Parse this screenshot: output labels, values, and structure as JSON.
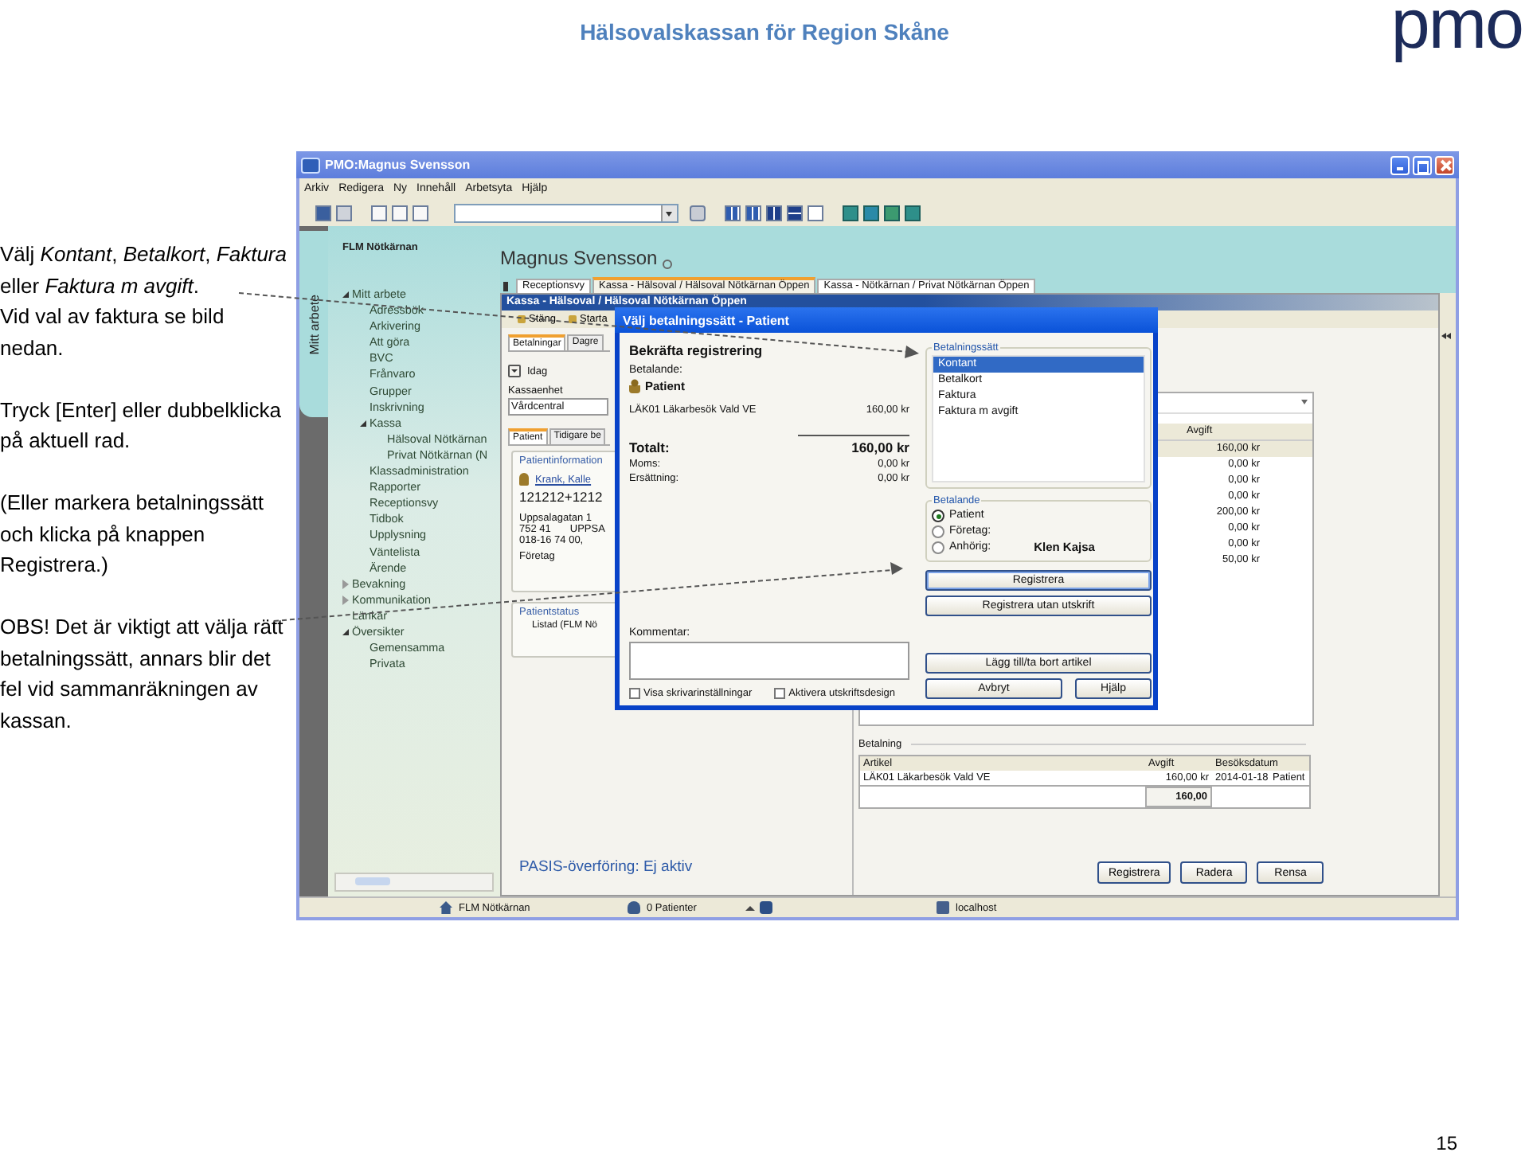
{
  "page_title": "Hälsovalskassan för Region Skåne",
  "logo": "pmo",
  "instructions": [
    "Välj *Kontant*, *Betalkort*, *Faktura* eller *Faktura m avgift*.",
    "Vid val av faktura se bild nedan.",
    "Tryck [Enter] eller dubbelklicka på aktuell rad.",
    "(Eller markera betalningssätt och klicka på knappen Registrera.)",
    "OBS! Det är viktigt att välja rätt betalningssätt, annars blir det fel vid sammanräkningen av kassan."
  ],
  "page_number": "15",
  "app": {
    "window_title": "PMO:Magnus Svensson",
    "menu": [
      "Arkiv",
      "Redigera",
      "Ny",
      "Innehåll",
      "Arbetsyta",
      "Hjälp"
    ],
    "side_tab": "Mitt arbete",
    "unit": "FLM Nötkärnan",
    "user": "Magnus Svensson",
    "tree": [
      {
        "label": "Mitt arbete",
        "expanded": true,
        "children": [
          {
            "label": "Adressbök"
          },
          {
            "label": "Arkivering"
          },
          {
            "label": "Att göra"
          },
          {
            "label": "BVC"
          },
          {
            "label": "Frånvaro"
          },
          {
            "label": "Grupper"
          },
          {
            "label": "Inskrivning"
          },
          {
            "label": "Kassa",
            "expanded": true,
            "children": [
              {
                "label": "Hälsoval Nötkärnan"
              },
              {
                "label": "Privat Nötkärnan (N"
              }
            ]
          },
          {
            "label": "Klassadministration"
          },
          {
            "label": "Rapporter"
          },
          {
            "label": "Receptionsvy"
          },
          {
            "label": "Tidbok"
          },
          {
            "label": "Upplysning"
          },
          {
            "label": "Väntelista"
          },
          {
            "label": "Ärende"
          }
        ]
      },
      {
        "label": "Bevakning",
        "expanded": false
      },
      {
        "label": "Kommunikation",
        "expanded": false
      },
      {
        "label": "Länkar"
      },
      {
        "label": "Översikter",
        "expanded": true,
        "children": [
          {
            "label": "Gemensamma"
          },
          {
            "label": "Privata"
          }
        ]
      }
    ],
    "tabs": [
      {
        "label": "Receptionsvy",
        "selected": false
      },
      {
        "label": "Kassa - Hälsoval / Hälsoval Nötkärnan Öppen",
        "selected": true
      },
      {
        "label": "Kassa - Nötkärnan / Privat Nötkärnan Öppen",
        "selected": false
      }
    ],
    "kassa": {
      "title": "Kassa - Hälsoval / Hälsoval Nötkärnan Öppen",
      "toolbar": [
        "Stäng",
        "Starta"
      ],
      "subtabs": [
        {
          "label": "Betalningar",
          "selected": true
        },
        {
          "label": "Dagre",
          "selected": false
        }
      ],
      "day": "Idag",
      "unit_label": "Kassaenhet",
      "unit_value": "Vårdcentral",
      "patient_tabs": [
        {
          "label": "Patient",
          "selected": true
        },
        {
          "label": "Tidigare be",
          "selected": false
        }
      ],
      "info_title": "Patientinformation",
      "patient_name": "Krank, Kalle",
      "personal_number": "121212+1212",
      "address": [
        "Uppsalagatan 1",
        "752 41",
        "UPPSA",
        "018-16 74 00,"
      ],
      "company": "Företag",
      "status_title": "Patientstatus",
      "status": "Listad (FLM Nö",
      "pasis": "PASIS-överföring: Ej aktiv",
      "fee_header": "Avgift",
      "fees": [
        {
          "amount": "160,00 kr",
          "selected": true
        },
        {
          "amount": "0,00 kr",
          "selected": false
        },
        {
          "amount": "0,00 kr",
          "selected": false
        },
        {
          "amount": "0,00 kr",
          "selected": false
        },
        {
          "amount": "200,00 kr",
          "selected": false
        },
        {
          "amount": "0,00 kr",
          "selected": false
        },
        {
          "amount": "0,00 kr",
          "selected": false
        },
        {
          "amount": "50,00 kr",
          "selected": false
        }
      ],
      "payment": {
        "title": "Betalning",
        "columns": [
          "Artikel",
          "Avgift",
          "Besöksdatum"
        ],
        "rows": [
          {
            "article": "LÄK01 Läkarbesök Vald VE",
            "fee": "160,00 kr",
            "date": "2014-01-18",
            "payer": "Patient"
          }
        ],
        "total": "160,00"
      },
      "buttons": [
        "Registrera",
        "Radera",
        "Rensa"
      ]
    },
    "dialog": {
      "title": "Välj betalningssätt - Patient",
      "heading": "Bekräfta registrering",
      "payer_label": "Betalande:",
      "payer": "Patient",
      "items": [
        {
          "article": "LÄK01 Läkarbesök Vald VE",
          "amount": "160,00 kr"
        }
      ],
      "total_label": "Totalt:",
      "total": "160,00 kr",
      "summary": [
        {
          "label": "Moms:",
          "amount": "0,00 kr"
        },
        {
          "label": "Ersättning:",
          "amount": "0,00 kr"
        }
      ],
      "comment_label": "Kommentar:",
      "options": [
        {
          "label": "Visa skrivarinställningar",
          "checked": false
        },
        {
          "label": "Aktivera utskriftsdesign",
          "checked": false
        }
      ],
      "methods_title": "Betalningssätt",
      "methods": [
        {
          "label": "Kontant",
          "selected": true
        },
        {
          "label": "Betalkort",
          "selected": false
        },
        {
          "label": "Faktura",
          "selected": false
        },
        {
          "label": "Faktura m avgift",
          "selected": false
        }
      ],
      "payers_title": "Betalande",
      "payers": [
        {
          "label": "Patient",
          "selected": true
        },
        {
          "label": "Företag:",
          "selected": false
        },
        {
          "label": "Anhörig:",
          "selected": false,
          "name": "Klen Kajsa"
        }
      ],
      "buttons": [
        {
          "label": "Registrera",
          "default": true
        },
        {
          "label": "Registrera utan utskrift",
          "default": false
        },
        {
          "label": "Lägg till/ta bort artikel",
          "default": false
        },
        {
          "label": "Avbryt",
          "default": false
        },
        {
          "label": "Hjälp",
          "default": false
        }
      ]
    },
    "status_bar": [
      {
        "kind": "unit",
        "label": "FLM Nötkärnan"
      },
      {
        "kind": "patients",
        "label": "0 Patienter"
      },
      {
        "kind": "connection"
      },
      {
        "kind": "server",
        "label": "localhost"
      }
    ]
  }
}
